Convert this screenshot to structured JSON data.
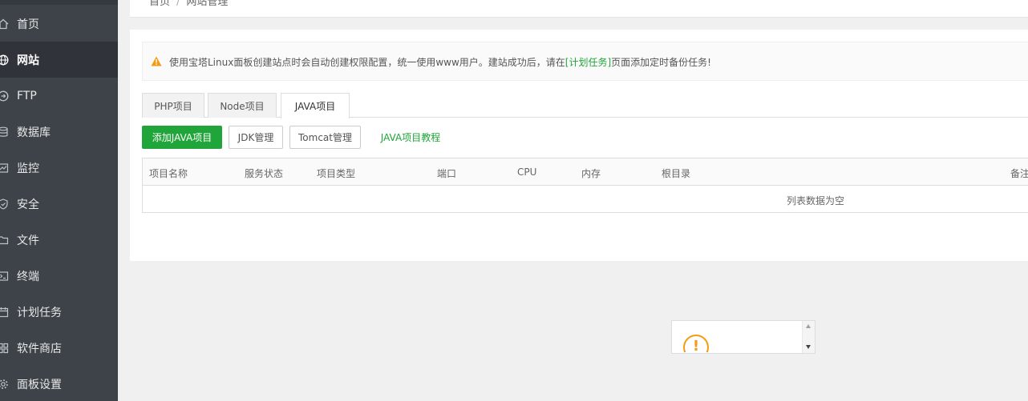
{
  "breadcrumb": {
    "home": "首页",
    "separator": "/",
    "current": "网站管理"
  },
  "sidebar": {
    "items": [
      {
        "label": "首页",
        "icon": "home-icon"
      },
      {
        "label": "网站",
        "icon": "globe-icon",
        "active": true
      },
      {
        "label": "FTP",
        "icon": "ftp-icon"
      },
      {
        "label": "数据库",
        "icon": "database-icon"
      },
      {
        "label": "监控",
        "icon": "monitor-icon"
      },
      {
        "label": "安全",
        "icon": "shield-icon"
      },
      {
        "label": "文件",
        "icon": "folder-icon"
      },
      {
        "label": "终端",
        "icon": "terminal-icon"
      },
      {
        "label": "计划任务",
        "icon": "calendar-icon"
      },
      {
        "label": "软件商店",
        "icon": "grid-icon"
      },
      {
        "label": "面板设置",
        "icon": "gear-icon"
      }
    ]
  },
  "notice": {
    "before": "使用宝塔Linux面板创建站点时会自动创建权限配置，统一使用www用户。建站成功后，请在",
    "link": "[计划任务]",
    "after": "页面添加定时备份任务!"
  },
  "tabs": [
    {
      "label": "PHP项目"
    },
    {
      "label": "Node项目"
    },
    {
      "label": "JAVA项目",
      "active": true
    }
  ],
  "toolbar": {
    "add": "添加JAVA项目",
    "jdk": "JDK管理",
    "tomcat": "Tomcat管理",
    "tutorial": "JAVA项目教程"
  },
  "table": {
    "columns": [
      "项目名称",
      "服务状态",
      "项目类型",
      "端口",
      "CPU",
      "内存",
      "根目录",
      "备注"
    ],
    "empty": "列表数据为空"
  },
  "colors": {
    "accent": "#20a53a",
    "sidebar": "#3e4349",
    "warning": "#f39c12"
  }
}
